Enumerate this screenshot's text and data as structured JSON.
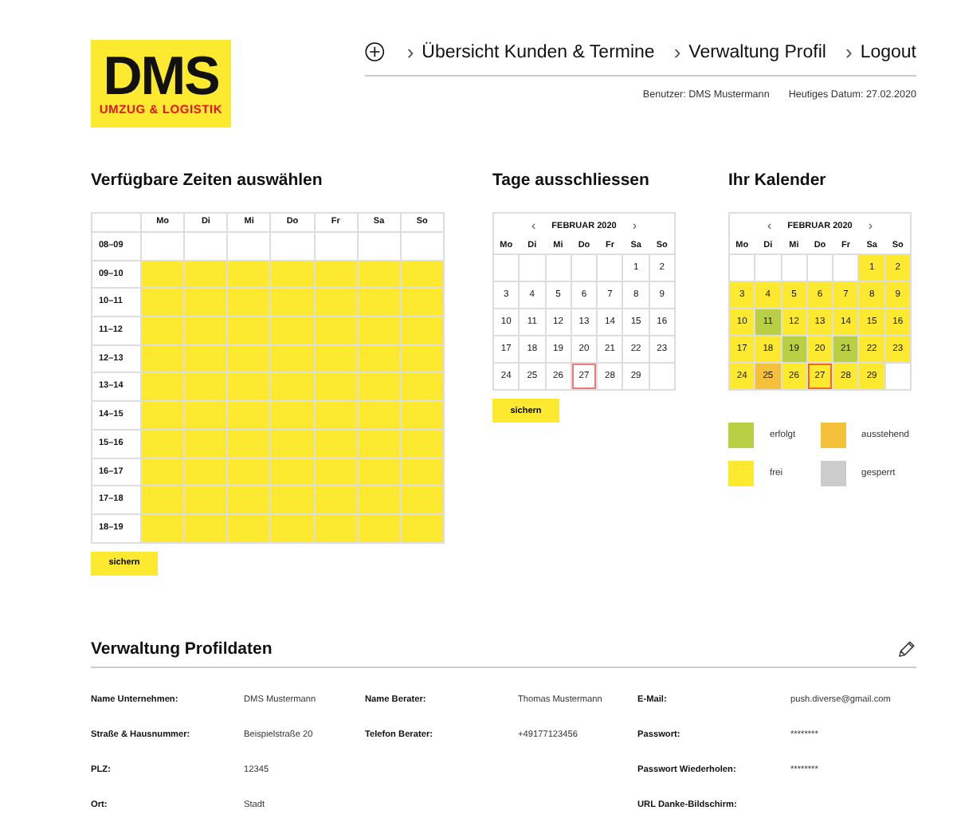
{
  "logo": {
    "title": "DMS",
    "subtitle": "UMZUG & LOGISTIK"
  },
  "nav": {
    "items": [
      {
        "label": "Übersicht Kunden & Termine",
        "chevron": "›"
      },
      {
        "label": "Verwaltung Profil",
        "chevron": "›"
      },
      {
        "label": "Logout",
        "chevron": "›"
      }
    ]
  },
  "user_info": {
    "user": "Benutzer: DMS Mustermann",
    "date": "Heutiges Datum: 27.02.2020"
  },
  "times": {
    "title": "Verfügbare Zeiten auswählen",
    "days": [
      "Mo",
      "Di",
      "Mi",
      "Do",
      "Fr",
      "Sa",
      "So"
    ],
    "rows": [
      {
        "label": "08–09",
        "slots": [
          {
            "selected": false
          },
          {
            "selected": false
          },
          {
            "selected": false
          },
          {
            "selected": false
          },
          {
            "selected": false
          },
          {
            "selected": false
          },
          {
            "selected": false
          }
        ]
      },
      {
        "label": "09–10",
        "slots": [
          {
            "selected": true
          },
          {
            "selected": true
          },
          {
            "selected": true
          },
          {
            "selected": true
          },
          {
            "selected": true
          },
          {
            "selected": true
          },
          {
            "selected": true
          }
        ]
      },
      {
        "label": "10–11",
        "slots": [
          {
            "selected": true
          },
          {
            "selected": true
          },
          {
            "selected": true
          },
          {
            "selected": true
          },
          {
            "selected": true
          },
          {
            "selected": true
          },
          {
            "selected": true
          }
        ]
      },
      {
        "label": "11–12",
        "slots": [
          {
            "selected": true
          },
          {
            "selected": true
          },
          {
            "selected": true
          },
          {
            "selected": true
          },
          {
            "selected": true
          },
          {
            "selected": true
          },
          {
            "selected": true
          }
        ]
      },
      {
        "label": "12–13",
        "slots": [
          {
            "selected": true
          },
          {
            "selected": true
          },
          {
            "selected": true
          },
          {
            "selected": true
          },
          {
            "selected": true
          },
          {
            "selected": true
          },
          {
            "selected": true
          }
        ]
      },
      {
        "label": "13–14",
        "slots": [
          {
            "selected": true
          },
          {
            "selected": true
          },
          {
            "selected": true
          },
          {
            "selected": true
          },
          {
            "selected": true
          },
          {
            "selected": true
          },
          {
            "selected": true
          }
        ]
      },
      {
        "label": "14–15",
        "slots": [
          {
            "selected": true
          },
          {
            "selected": true
          },
          {
            "selected": true
          },
          {
            "selected": true
          },
          {
            "selected": true
          },
          {
            "selected": true
          },
          {
            "selected": true
          }
        ]
      },
      {
        "label": "15–16",
        "slots": [
          {
            "selected": true
          },
          {
            "selected": true
          },
          {
            "selected": true
          },
          {
            "selected": true
          },
          {
            "selected": true
          },
          {
            "selected": true
          },
          {
            "selected": true
          }
        ]
      },
      {
        "label": "16–17",
        "slots": [
          {
            "selected": true
          },
          {
            "selected": true
          },
          {
            "selected": true
          },
          {
            "selected": true
          },
          {
            "selected": true
          },
          {
            "selected": true
          },
          {
            "selected": true
          }
        ]
      },
      {
        "label": "17–18",
        "slots": [
          {
            "selected": true
          },
          {
            "selected": true
          },
          {
            "selected": true
          },
          {
            "selected": true
          },
          {
            "selected": true
          },
          {
            "selected": true
          },
          {
            "selected": true
          }
        ]
      },
      {
        "label": "18–19",
        "slots": [
          {
            "selected": true
          },
          {
            "selected": true
          },
          {
            "selected": true
          },
          {
            "selected": true
          },
          {
            "selected": true
          },
          {
            "selected": true
          },
          {
            "selected": true
          }
        ]
      }
    ],
    "save_button": "sichern"
  },
  "exclude": {
    "title": "Tage ausschliessen",
    "prev": "‹",
    "month": "FEBRUAR 2020",
    "next": "›",
    "days": [
      "Mo",
      "Di",
      "Mi",
      "Do",
      "Fr",
      "Sa",
      "So"
    ],
    "weeks": [
      [
        {
          "kind": "blank"
        },
        {
          "kind": "blank"
        },
        {
          "kind": "blank"
        },
        {
          "kind": "blank"
        },
        {
          "kind": "blank"
        },
        {
          "kind": "day",
          "day": "1",
          "today": false
        },
        {
          "kind": "day",
          "day": "2",
          "today": false
        }
      ],
      [
        {
          "kind": "day",
          "day": "3",
          "today": false
        },
        {
          "kind": "day",
          "day": "4",
          "today": false
        },
        {
          "kind": "day",
          "day": "5",
          "today": false
        },
        {
          "kind": "day",
          "day": "6",
          "today": false
        },
        {
          "kind": "day",
          "day": "7",
          "today": false
        },
        {
          "kind": "day",
          "day": "8",
          "today": false
        },
        {
          "kind": "day",
          "day": "9",
          "today": false
        }
      ],
      [
        {
          "kind": "day",
          "day": "10",
          "today": false
        },
        {
          "kind": "day",
          "day": "11",
          "today": false
        },
        {
          "kind": "day",
          "day": "12",
          "today": false
        },
        {
          "kind": "day",
          "day": "13",
          "today": false
        },
        {
          "kind": "day",
          "day": "14",
          "today": false
        },
        {
          "kind": "day",
          "day": "15",
          "today": false
        },
        {
          "kind": "day",
          "day": "16",
          "today": false
        }
      ],
      [
        {
          "kind": "day",
          "day": "17",
          "today": false
        },
        {
          "kind": "day",
          "day": "18",
          "today": false
        },
        {
          "kind": "day",
          "day": "19",
          "today": false
        },
        {
          "kind": "day",
          "day": "20",
          "today": false
        },
        {
          "kind": "day",
          "day": "21",
          "today": false
        },
        {
          "kind": "day",
          "day": "22",
          "today": false
        },
        {
          "kind": "day",
          "day": "23",
          "today": false
        }
      ],
      [
        {
          "kind": "day",
          "day": "24",
          "today": false
        },
        {
          "kind": "day",
          "day": "25",
          "today": false
        },
        {
          "kind": "day",
          "day": "26",
          "today": false
        },
        {
          "kind": "day",
          "day": "27",
          "today": true
        },
        {
          "kind": "day",
          "day": "28",
          "today": false
        },
        {
          "kind": "day",
          "day": "29",
          "today": false
        },
        {
          "kind": "blank"
        }
      ]
    ],
    "save_button": "sichern"
  },
  "calendar": {
    "title": "Ihr Kalender",
    "prev": "‹",
    "month": "FEBRUAR 2020",
    "next": "›",
    "days": [
      "Mo",
      "Di",
      "Mi",
      "Do",
      "Fr",
      "Sa",
      "So"
    ],
    "weeks": [
      [
        {
          "kind": "blank"
        },
        {
          "kind": "blank"
        },
        {
          "kind": "blank"
        },
        {
          "kind": "blank"
        },
        {
          "kind": "blank"
        },
        {
          "kind": "day",
          "day": "1",
          "color": "#fde92f",
          "today": false
        },
        {
          "kind": "day",
          "day": "2",
          "color": "#fde92f",
          "today": false
        }
      ],
      [
        {
          "kind": "day",
          "day": "3",
          "color": "#fde92f",
          "today": false
        },
        {
          "kind": "day",
          "day": "4",
          "color": "#fde92f",
          "today": false
        },
        {
          "kind": "day",
          "day": "5",
          "color": "#fde92f",
          "today": false
        },
        {
          "kind": "day",
          "day": "6",
          "color": "#fde92f",
          "today": false
        },
        {
          "kind": "day",
          "day": "7",
          "color": "#fde92f",
          "today": false
        },
        {
          "kind": "day",
          "day": "8",
          "color": "#fde92f",
          "today": false
        },
        {
          "kind": "day",
          "day": "9",
          "color": "#fde92f",
          "today": false
        }
      ],
      [
        {
          "kind": "day",
          "day": "10",
          "color": "#fde92f",
          "today": false
        },
        {
          "kind": "day",
          "day": "11",
          "color": "#b9cf44",
          "today": false
        },
        {
          "kind": "day",
          "day": "12",
          "color": "#fde92f",
          "today": false
        },
        {
          "kind": "day",
          "day": "13",
          "color": "#fde92f",
          "today": false
        },
        {
          "kind": "day",
          "day": "14",
          "color": "#fde92f",
          "today": false
        },
        {
          "kind": "day",
          "day": "15",
          "color": "#fde92f",
          "today": false
        },
        {
          "kind": "day",
          "day": "16",
          "color": "#fde92f",
          "today": false
        }
      ],
      [
        {
          "kind": "day",
          "day": "17",
          "color": "#fde92f",
          "today": false
        },
        {
          "kind": "day",
          "day": "18",
          "color": "#fde92f",
          "today": false
        },
        {
          "kind": "day",
          "day": "19",
          "color": "#b9cf44",
          "today": false
        },
        {
          "kind": "day",
          "day": "20",
          "color": "#fde92f",
          "today": false
        },
        {
          "kind": "day",
          "day": "21",
          "color": "#b9cf44",
          "today": false
        },
        {
          "kind": "day",
          "day": "22",
          "color": "#fde92f",
          "today": false
        },
        {
          "kind": "day",
          "day": "23",
          "color": "#fde92f",
          "today": false
        }
      ],
      [
        {
          "kind": "day",
          "day": "24",
          "color": "#fde92f",
          "today": false
        },
        {
          "kind": "day",
          "day": "25",
          "color": "#f5c13a",
          "today": false
        },
        {
          "kind": "day",
          "day": "26",
          "color": "#fde92f",
          "today": false
        },
        {
          "kind": "day",
          "day": "27",
          "color": "#fde92f",
          "today": true
        },
        {
          "kind": "day",
          "day": "28",
          "color": "#fde92f",
          "today": false
        },
        {
          "kind": "day",
          "day": "29",
          "color": "#fde92f",
          "today": false
        },
        {
          "kind": "blank"
        }
      ]
    ],
    "legend": [
      {
        "label": "erfolgt",
        "color": "#b9cf44"
      },
      {
        "label": "ausstehend",
        "color": "#f5c13a"
      },
      {
        "label": "frei",
        "color": "#fde92f"
      },
      {
        "label": "gesperrt",
        "color": "#cccccc"
      }
    ]
  },
  "profile": {
    "title": "Verwaltung Profildaten",
    "columns": [
      [
        {
          "label": "Name Unternehmen:",
          "value": "DMS Mustermann"
        },
        {
          "label": "Straße & Hausnummer:",
          "value": "Beispielstraße 20"
        },
        {
          "label": "PLZ:",
          "value": "12345"
        },
        {
          "label": "Ort:",
          "value": "Stadt"
        }
      ],
      [
        {
          "label": "Name Berater:",
          "value": "Thomas Mustermann"
        },
        {
          "label": "Telefon Berater:",
          "value": "+49177123456"
        }
      ],
      [
        {
          "label": "E-Mail:",
          "value": "push.diverse@gmail.com"
        },
        {
          "label": "Passwort:",
          "value": "********"
        },
        {
          "label": "Passwort Wiederholen:",
          "value": "********"
        },
        {
          "label": "URL Danke-Bildschirm:"
        }
      ]
    ]
  }
}
